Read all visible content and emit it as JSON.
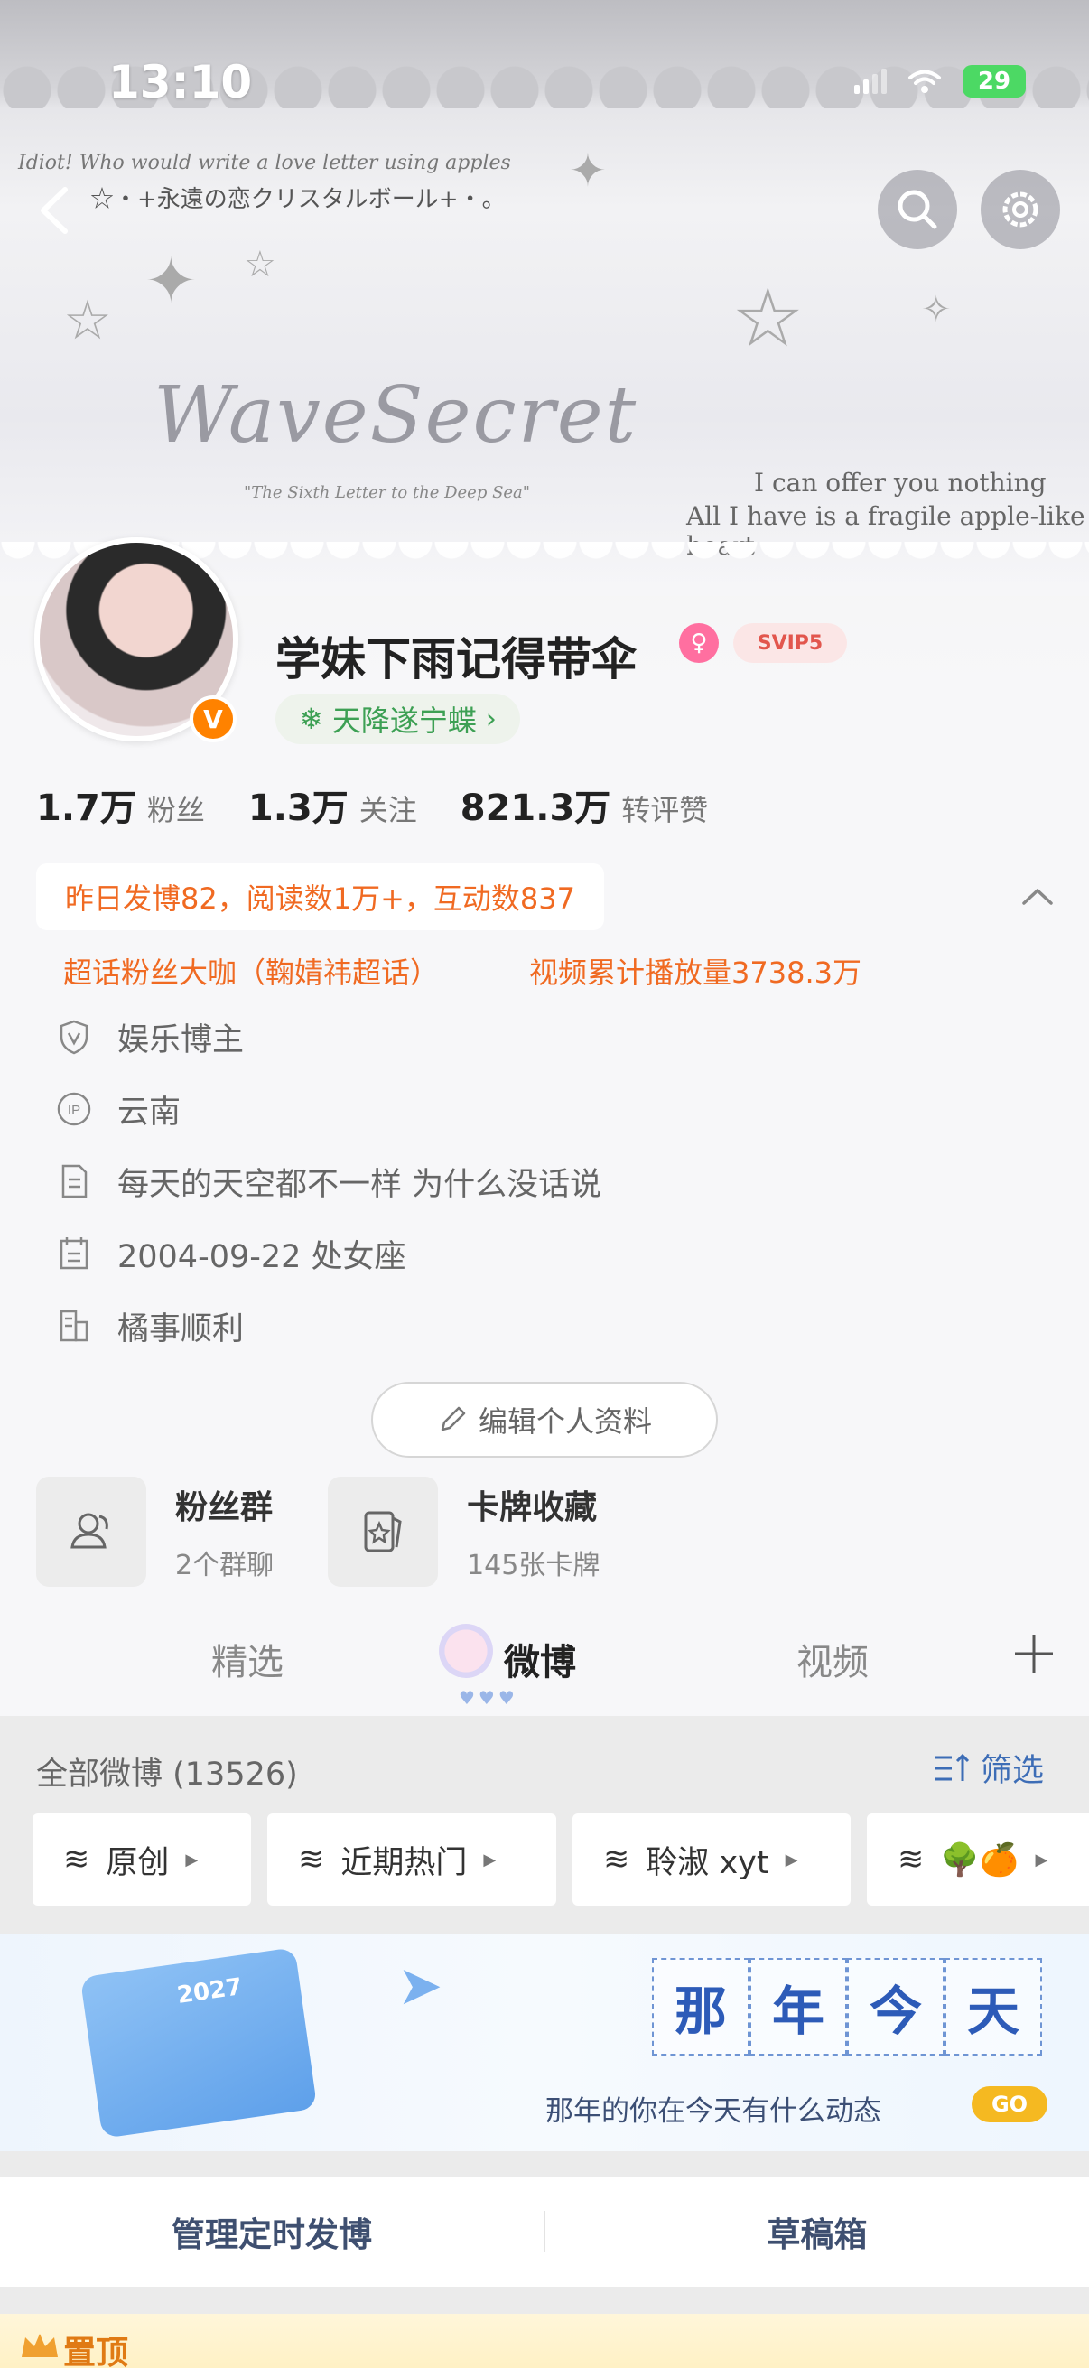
{
  "status_bar": {
    "time": "13:10",
    "battery": "29"
  },
  "banner": {
    "top_line": "Idiot! Who would write a love letter using apples",
    "caption": "☆・+永遠の恋クリスタルボール+・。",
    "art_title": "WaveSecret",
    "art_subtitle": "\"The Sixth Letter to the Deep Sea\"",
    "art_right_line1": "I can offer you nothing",
    "art_right_line2": "All I have is a fragile apple-like heart"
  },
  "profile": {
    "username": "学妹下雨记得带伞",
    "verified_mark": "V",
    "svip_label": "SVIP5",
    "fan_group_tag": "天降遂宁蝶",
    "stats": [
      {
        "num": "1.7万",
        "label": "粉丝"
      },
      {
        "num": "1.3万",
        "label": "关注"
      },
      {
        "num": "821.3万",
        "label": "转评赞"
      }
    ],
    "daily_summary": "昨日发博82，阅读数1万+，互动数837",
    "achievements": [
      "超话粉丝大咖（鞠婧祎超话）",
      "视频累计播放量3738.3万"
    ],
    "info": [
      {
        "icon": "shield-v-icon",
        "text": "娱乐博主"
      },
      {
        "icon": "ip-location-icon",
        "text": "云南"
      },
      {
        "icon": "document-icon",
        "text": "每天的天空都不一样 为什么没话说"
      },
      {
        "icon": "calendar-icon",
        "text": "2004-09-22 处女座"
      },
      {
        "icon": "building-icon",
        "text": "橘事顺利"
      }
    ],
    "edit_button": "编辑个人资料",
    "quick_cards": [
      {
        "title": "粉丝群",
        "sub": "2个群聊"
      },
      {
        "title": "卡牌收藏",
        "sub": "145张卡牌"
      }
    ]
  },
  "tabs": [
    "精选",
    "微博",
    "视频"
  ],
  "feed": {
    "header": "全部微博 (13526)",
    "filter_label": "筛选",
    "chips": [
      "原创",
      "近期热门",
      "聆淑 xyt",
      "🌳🍊"
    ],
    "memory_banner": {
      "calendar_year": "2027",
      "title_chars": [
        "那",
        "年",
        "今",
        "天"
      ],
      "subtitle": "那年的你在今天有什么动态",
      "go_label": "GO"
    },
    "manage_items": [
      "管理定时发博",
      "草稿箱"
    ],
    "pinned_label": "置顶"
  },
  "colors": {
    "accent_orange": "#f06a22",
    "link_blue": "#3d6db6",
    "green_tag": "#3da054",
    "verified_orange": "#ff8200"
  }
}
